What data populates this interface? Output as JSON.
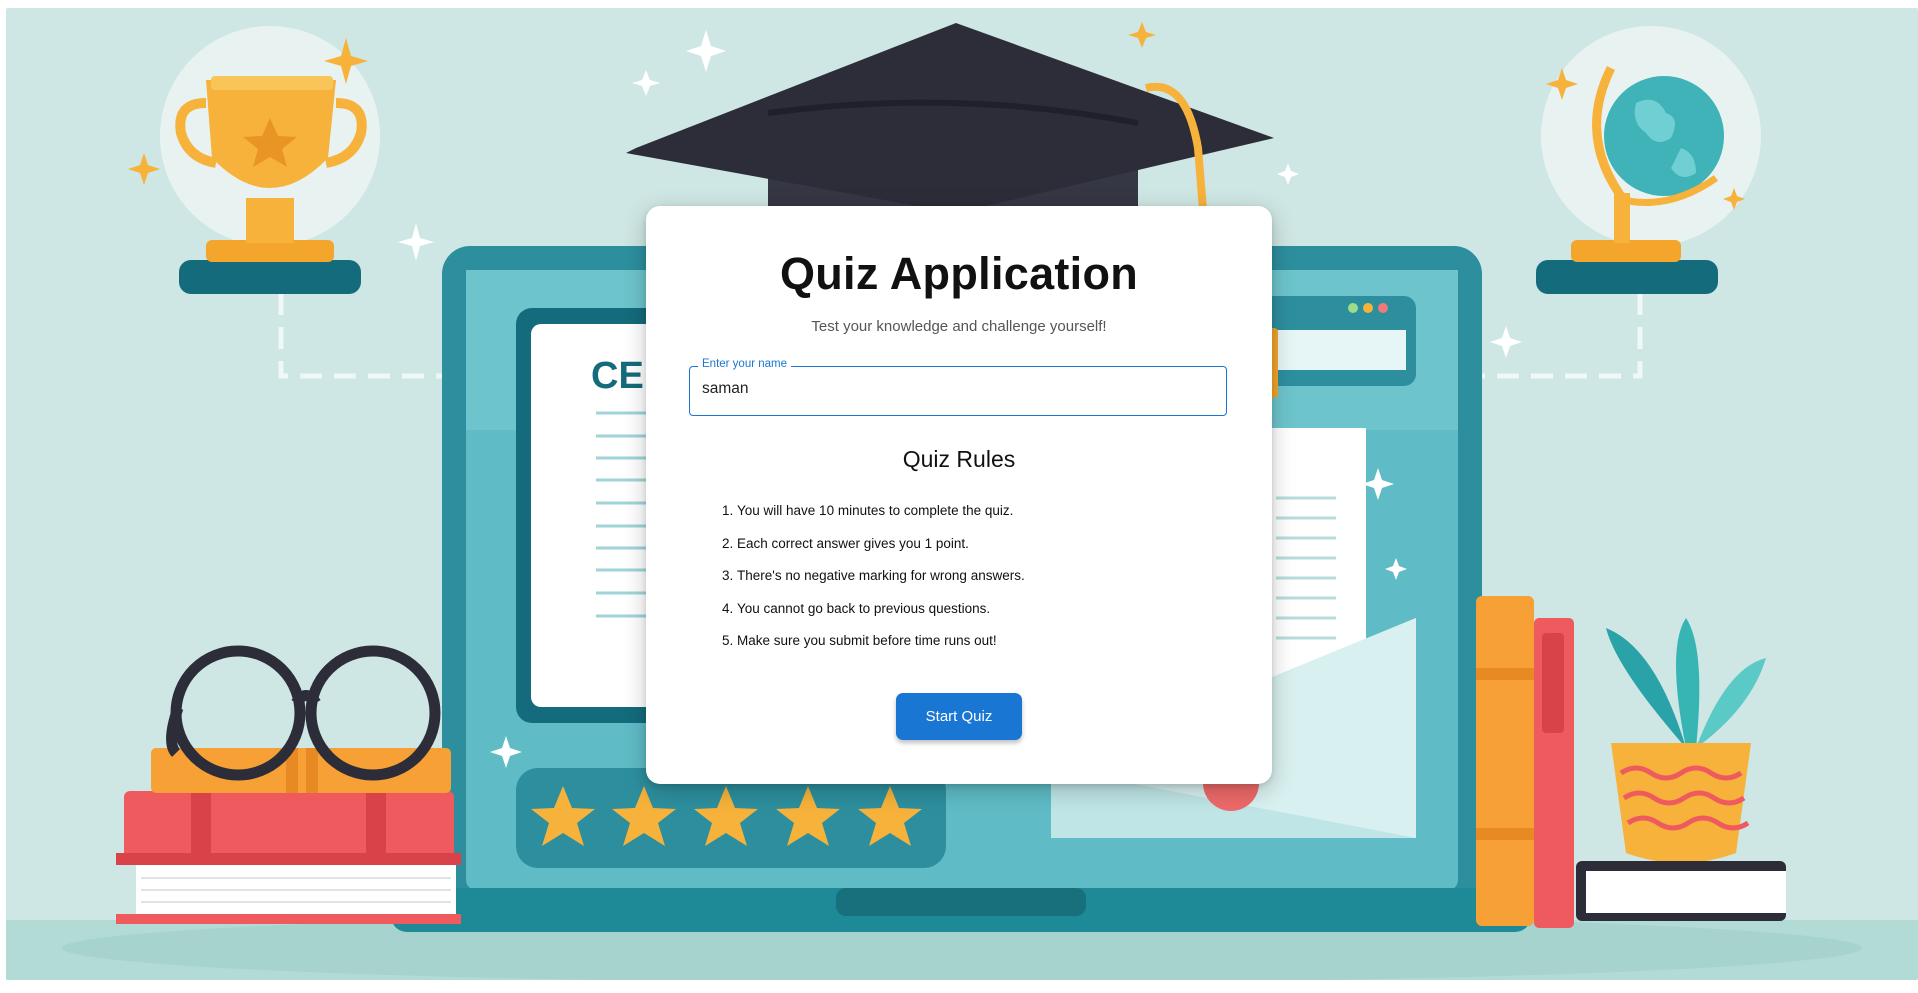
{
  "app": {
    "title": "Quiz Application",
    "subtitle": "Test your knowledge and challenge yourself!"
  },
  "name_field": {
    "label": "Enter your name",
    "value": "saman"
  },
  "rules": {
    "heading": "Quiz Rules",
    "items": [
      "You will have 10 minutes to complete the quiz.",
      "Each correct answer gives you 1 point.",
      "There's no negative marking for wrong answers.",
      "You cannot go back to previous questions.",
      "Make sure you submit before time runs out!"
    ]
  },
  "actions": {
    "start_label": "Start Quiz"
  },
  "illustration": {
    "certificate_text": "CE"
  },
  "colors": {
    "primary": "#1976d2",
    "background": "#cfe7e4",
    "teal_dark": "#146b7c",
    "gold": "#f6b23a"
  }
}
